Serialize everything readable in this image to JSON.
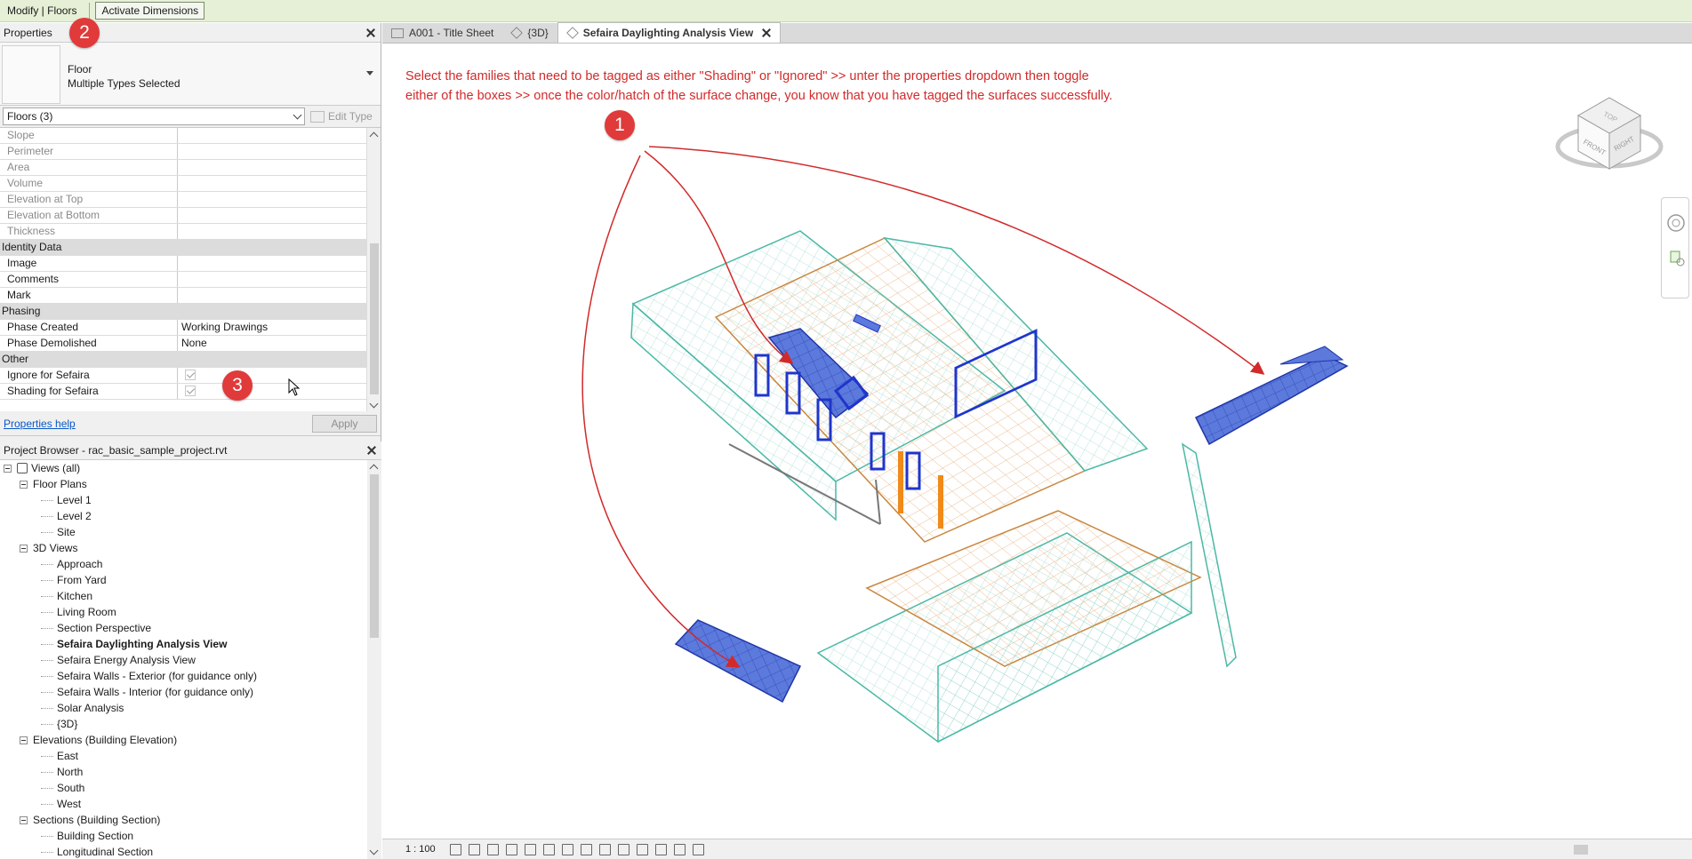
{
  "ribbon": {
    "context_label": "Modify | Floors",
    "activate_dimensions": "Activate Dimensions"
  },
  "properties": {
    "title": "Properties",
    "type_name": "Floor",
    "type_sub": "Multiple Types Selected",
    "filter": "Floors (3)",
    "edit_type": "Edit Type",
    "rows": [
      {
        "key": "Slope",
        "value": "",
        "dim": true
      },
      {
        "key": "Perimeter",
        "value": "",
        "dim": true
      },
      {
        "key": "Area",
        "value": "",
        "dim": true
      },
      {
        "key": "Volume",
        "value": "",
        "dim": true
      },
      {
        "key": "Elevation at Top",
        "value": "",
        "dim": true
      },
      {
        "key": "Elevation at Bottom",
        "value": "",
        "dim": true
      },
      {
        "key": "Thickness",
        "value": "",
        "dim": true
      }
    ],
    "identity": {
      "label": "Identity Data",
      "rows": [
        {
          "key": "Image",
          "value": ""
        },
        {
          "key": "Comments",
          "value": ""
        },
        {
          "key": "Mark",
          "value": ""
        }
      ]
    },
    "phasing": {
      "label": "Phasing",
      "rows": [
        {
          "key": "Phase Created",
          "value": "Working Drawings"
        },
        {
          "key": "Phase Demolished",
          "value": "None"
        }
      ]
    },
    "other": {
      "label": "Other",
      "rows": [
        {
          "key": "Ignore for Sefaira"
        },
        {
          "key": "Shading for Sefaira"
        }
      ]
    },
    "help": "Properties help",
    "apply": "Apply"
  },
  "browser": {
    "title": "Project Browser - rac_basic_sample_project.rvt",
    "root": "Views (all)",
    "floor_plans": {
      "label": "Floor Plans",
      "items": [
        "Level 1",
        "Level 2",
        "Site"
      ]
    },
    "views3d": {
      "label": "3D Views",
      "items": [
        "Approach",
        "From Yard",
        "Kitchen",
        "Living Room",
        "Section Perspective",
        "Sefaira Daylighting Analysis View",
        "Sefaira Energy Analysis View",
        "Sefaira Walls - Exterior (for guidance only)",
        "Sefaira Walls - Interior (for guidance only)",
        "Solar Analysis",
        "{3D}"
      ]
    },
    "elevations": {
      "label": "Elevations (Building Elevation)",
      "items": [
        "East",
        "North",
        "South",
        "West"
      ]
    },
    "sections": {
      "label": "Sections (Building Section)",
      "items": [
        "Building Section",
        "Longitudinal Section"
      ]
    }
  },
  "tabs": [
    {
      "label": "A001 - Title Sheet"
    },
    {
      "label": "{3D}"
    },
    {
      "label": "Sefaira Daylighting Analysis View",
      "active": true
    }
  ],
  "canvas": {
    "note_line1": "Select the families that need to be tagged as either \"Shading\" or \"Ignored\" >> unter the properties dropdown then toggle",
    "note_line2": "either of the boxes >> once the color/hatch of the surface change, you know that you have tagged the surfaces successfully.",
    "markers": [
      "1",
      "2",
      "3"
    ],
    "viewcube": {
      "top": "TOP",
      "front": "FRONT",
      "right": "RIGHT"
    }
  },
  "status": {
    "scale": "1 : 100"
  },
  "colors": {
    "annotation": "#d22a2a",
    "tagged_surface": "#4f6fd8",
    "wire": "#5bc0b0",
    "roof": "#e9c9a0"
  }
}
